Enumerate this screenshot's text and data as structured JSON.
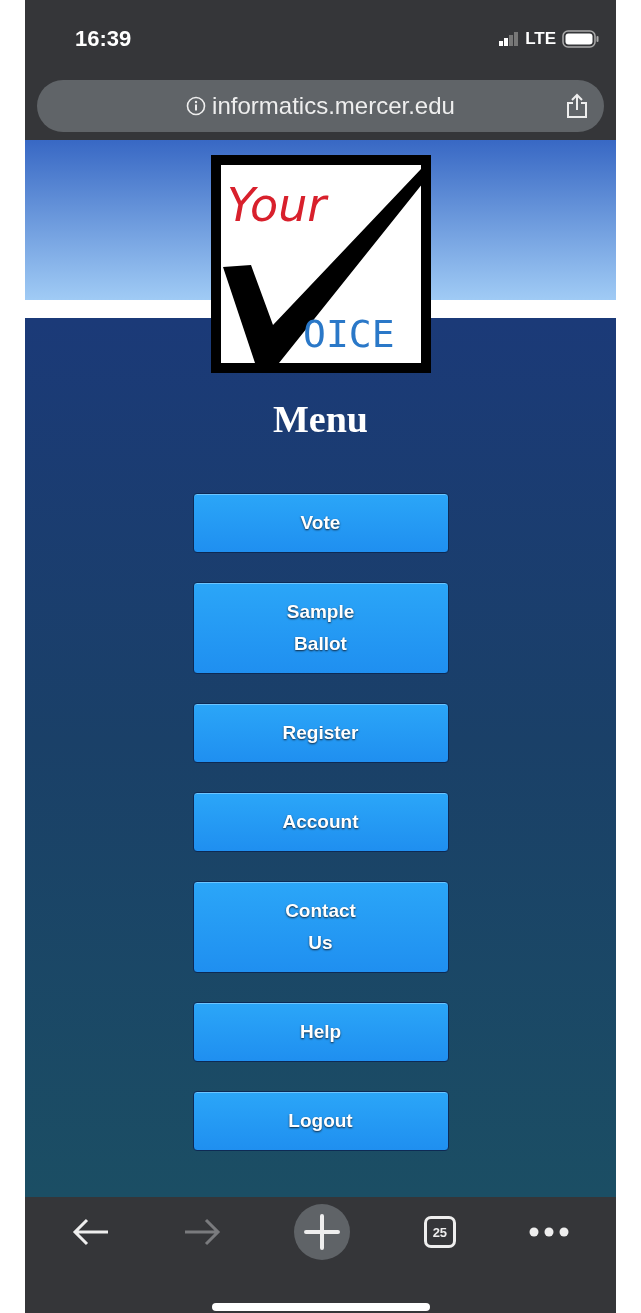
{
  "status_bar": {
    "time": "16:39",
    "network": "LTE"
  },
  "address_bar": {
    "url": "informatics.mercer.edu"
  },
  "logo": {
    "top_text": "Your",
    "bottom_text": "OICE"
  },
  "title": "Menu",
  "menu_buttons": [
    {
      "label": "Vote"
    },
    {
      "label": "Sample\nBallot"
    },
    {
      "label": "Register"
    },
    {
      "label": "Account"
    },
    {
      "label": "Contact\nUs"
    },
    {
      "label": "Help"
    },
    {
      "label": "Logout"
    }
  ],
  "toolbar": {
    "forward_disabled": true,
    "tab_count": "25"
  }
}
